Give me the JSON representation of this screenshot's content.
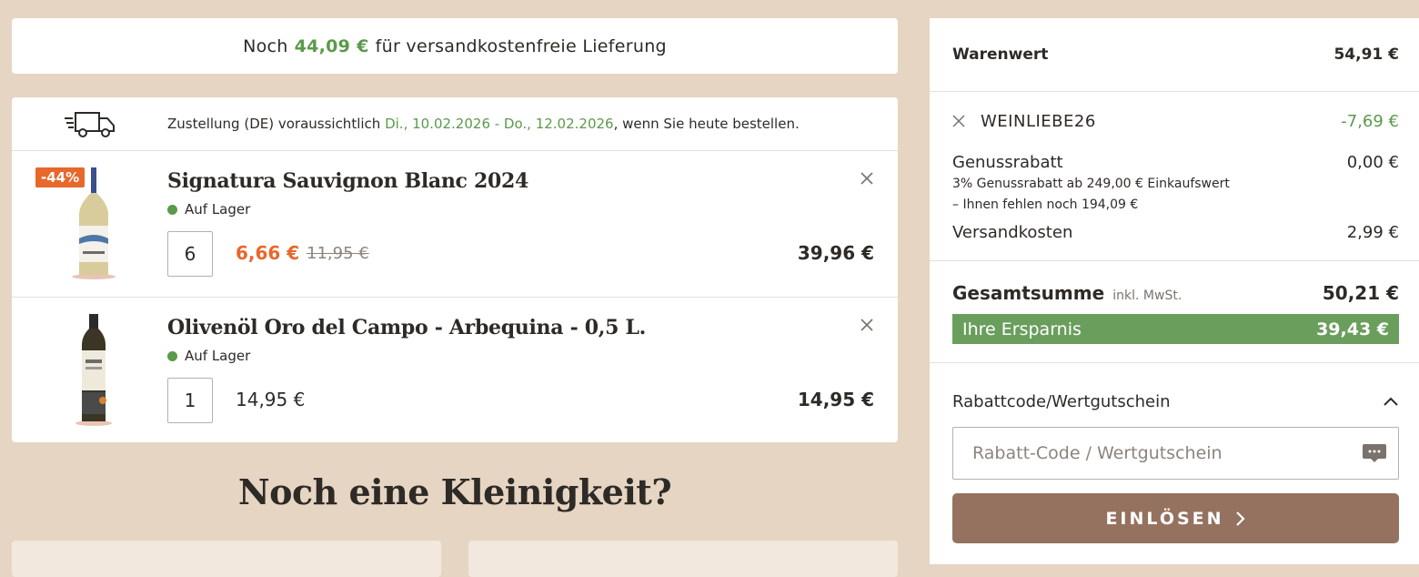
{
  "shipping_banner": {
    "prefix": "Noch",
    "amount": "44,09 €",
    "suffix": "für versandkostenfreie Lieferung"
  },
  "delivery": {
    "prefix": "Zustellung (DE) voraussichtlich",
    "dates": "Di., 10.02.2026 - Do., 12.02.2026",
    "suffix": ", wenn Sie heute bestellen."
  },
  "cart_items": [
    {
      "name": "Signatura Sauvignon Blanc 2024",
      "badge": "-44%",
      "stock": "Auf Lager",
      "quantity": "6",
      "price": "6,66 €",
      "old_price": "11,95 €",
      "total": "39,96 €"
    },
    {
      "name": "Olivenöl Oro del Campo - Arbequina - 0,5 L.",
      "stock": "Auf Lager",
      "quantity": "1",
      "price": "14,95 €",
      "total": "14,95 €"
    }
  ],
  "upsell_title": "Noch eine Kleinigkeit?",
  "summary": {
    "goods_label": "Warenwert",
    "goods_value": "54,91 €",
    "coupon_code": "WEINLIEBE26",
    "coupon_value": "-7,69 €",
    "discount_label": "Genussrabatt",
    "discount_value": "0,00 €",
    "discount_note_1": "3% Genussrabatt ab 249,00 € Einkaufswert",
    "discount_note_2": "– Ihnen fehlen noch 194,09 €",
    "shipping_label": "Versandkosten",
    "shipping_value": "2,99 €",
    "total_label": "Gesamtsumme",
    "total_note": "inkl. MwSt.",
    "total_value": "50,21 €",
    "savings_label": "Ihre Ersparnis",
    "savings_value": "39,43 €",
    "code_section_label": "Rabattcode/Wertgutschein",
    "code_placeholder": "Rabatt-Code / Wertgutschein",
    "redeem_label": "EINLÖSEN"
  },
  "colors": {
    "accent_green": "#5a9a4b",
    "sale_orange": "#e8672a",
    "button_brown": "#94725f",
    "background": "#e6d5c3"
  },
  "icons": [
    "truck-icon",
    "close-icon",
    "chevron-up-icon",
    "keyboard-icon",
    "chevron-right-icon"
  ]
}
